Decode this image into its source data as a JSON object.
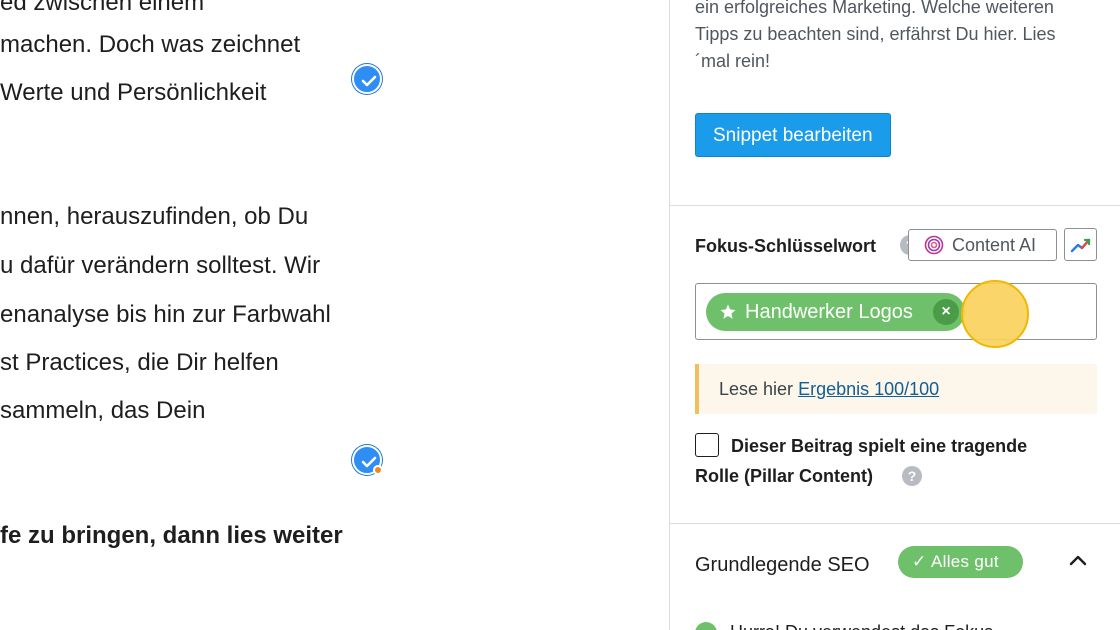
{
  "editor": {
    "lines": [
      "ed zwischen einem",
      "machen. Doch was zeichnet",
      " Werte und Persönlichkeit",
      "nnen, herauszufinden, ob Du",
      "u dafür verändern solltest. Wir",
      "enanalyse bis hin zur Farbwahl",
      "st Practices, die Dir helfen",
      "sammeln, das Dein",
      "fe zu bringen, dann lies weiter"
    ]
  },
  "sidebar": {
    "snippet_description": "ein erfolgreiches Marketing. Welche weiteren Tipps zu beachten sind, erfährst Du hier. Lies ´mal rein!",
    "snippet_button": "Snippet bearbeiten",
    "focus_keyword_label": "Fokus-Schlüsselwort",
    "help_glyph": "?",
    "content_ai_button": "Content AI",
    "keyword_tag": "Handwerker Logos",
    "keyword_remove_glyph": "×",
    "notice_prefix": "Lese hier ",
    "notice_link": "Ergebnis 100/100",
    "pillar_line1": "Dieser Beitrag spielt eine tragende",
    "pillar_line2": "Rolle (Pillar Content)",
    "basic_seo_title": "Grundlegende SEO",
    "basic_seo_badge": "Alles gut",
    "badge_check": "✓",
    "bottom_partial": "Hurra! Du verwendest das Fokus"
  },
  "colors": {
    "primary_button": "#1a9cea",
    "success_green": "#6fc06b",
    "notice_border": "#f2c05a",
    "check_blue": "#2f8ef3",
    "link": "#135e96"
  },
  "icons": [
    "check-circle-icon",
    "help-icon",
    "content-ai-icon",
    "trend-icon",
    "star-icon",
    "close-icon",
    "chevron-up-icon"
  ]
}
